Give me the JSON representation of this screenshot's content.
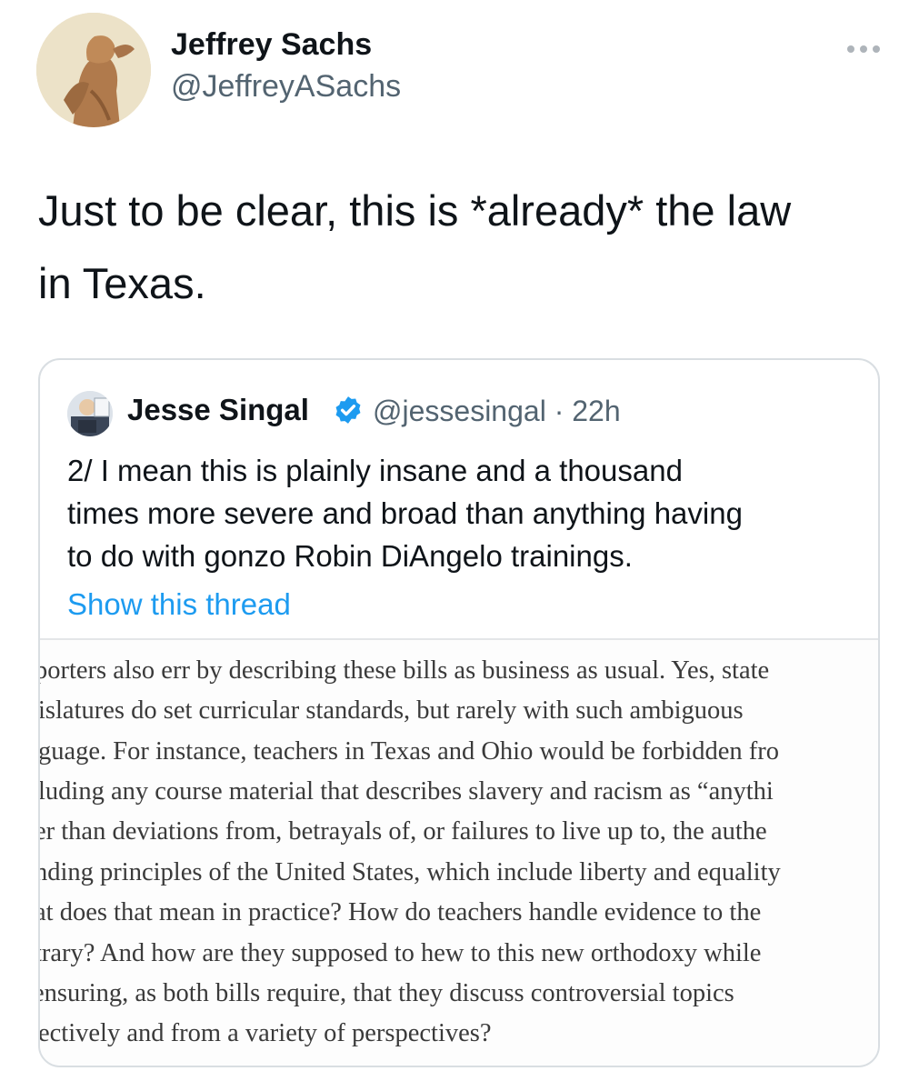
{
  "tweet": {
    "author_name": "Jeffrey Sachs",
    "author_handle": "@JeffreyASachs",
    "text_line1": "Just to be clear, this is *already* the law",
    "text_line2": "in Texas.",
    "more_icon": "more-horizontal-icon"
  },
  "quoted_tweet": {
    "author_name": "Jesse Singal",
    "verified_icon": "verified-badge-icon",
    "handle_time": "@jessesingal · 22h",
    "text_line1": "2/ I mean this is plainly insane and a thousand",
    "text_line2": "times more severe and broad than anything having",
    "text_line3": "to do with gonzo Robin DiAngelo trainings.",
    "show_thread": "Show this thread",
    "link_color": "#1d9bf0",
    "article_lines": [
      "porters also err by describing these bills as business as usual. Yes, state",
      "islatures do set curricular standards, but rarely with such ambiguous",
      "guage. For instance, teachers in Texas and Ohio would be forbidden fro",
      "luding any course material that describes slavery and racism as “anythi",
      "er than deviations from, betrayals of, or failures to live up to, the authe",
      "nding principles of the United States, which include liberty and equality",
      "at does that mean in practice? How do teachers handle evidence to the",
      "trary? And how are they supposed to hew to this new orthodoxy while",
      "ensuring, as both bills require, that they discuss controversial topics",
      "ectively and from a variety of perspectives?"
    ]
  }
}
